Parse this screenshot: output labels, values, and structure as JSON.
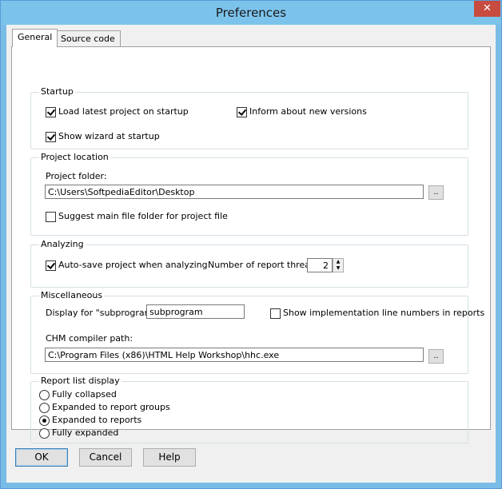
{
  "window": {
    "title": "Preferences",
    "close_glyph": "✕"
  },
  "tabs": [
    {
      "label": "General"
    },
    {
      "label": "Source code"
    }
  ],
  "startup": {
    "legend": "Startup",
    "load_latest": {
      "label": "Load latest project on startup",
      "checked": true
    },
    "inform_versions": {
      "label": "Inform about new versions",
      "checked": true
    },
    "show_wizard": {
      "label": "Show wizard at startup",
      "checked": true
    }
  },
  "project_location": {
    "legend": "Project location",
    "folder_label": "Project folder:",
    "folder_value": "C:\\Users\\SoftpediaEditor\\Desktop",
    "browse_label": "..",
    "suggest_main": {
      "label": "Suggest main file folder for project file",
      "checked": false
    }
  },
  "analyzing": {
    "legend": "Analyzing",
    "auto_save": {
      "label": "Auto-save project when analyzing",
      "checked": true
    },
    "threads_label": "Number of report threads:",
    "threads_value": "2"
  },
  "misc": {
    "legend": "Miscellaneous",
    "subprogram_label": "Display for \"subprogram\":",
    "subprogram_value": "subprogram",
    "show_line_numbers": {
      "label": "Show implementation line numbers in reports",
      "checked": false
    },
    "chm_label": "CHM compiler path:",
    "chm_value": "C:\\Program Files (x86)\\HTML Help Workshop\\hhc.exe",
    "browse_label": ".."
  },
  "report_list": {
    "legend": "Report list display",
    "options": [
      {
        "label": "Fully collapsed",
        "selected": false
      },
      {
        "label": "Expanded to report groups",
        "selected": false
      },
      {
        "label": "Expanded to reports",
        "selected": true
      },
      {
        "label": "Fully expanded",
        "selected": false
      }
    ]
  },
  "buttons": {
    "ok": "OK",
    "cancel": "Cancel",
    "help": "Help"
  }
}
